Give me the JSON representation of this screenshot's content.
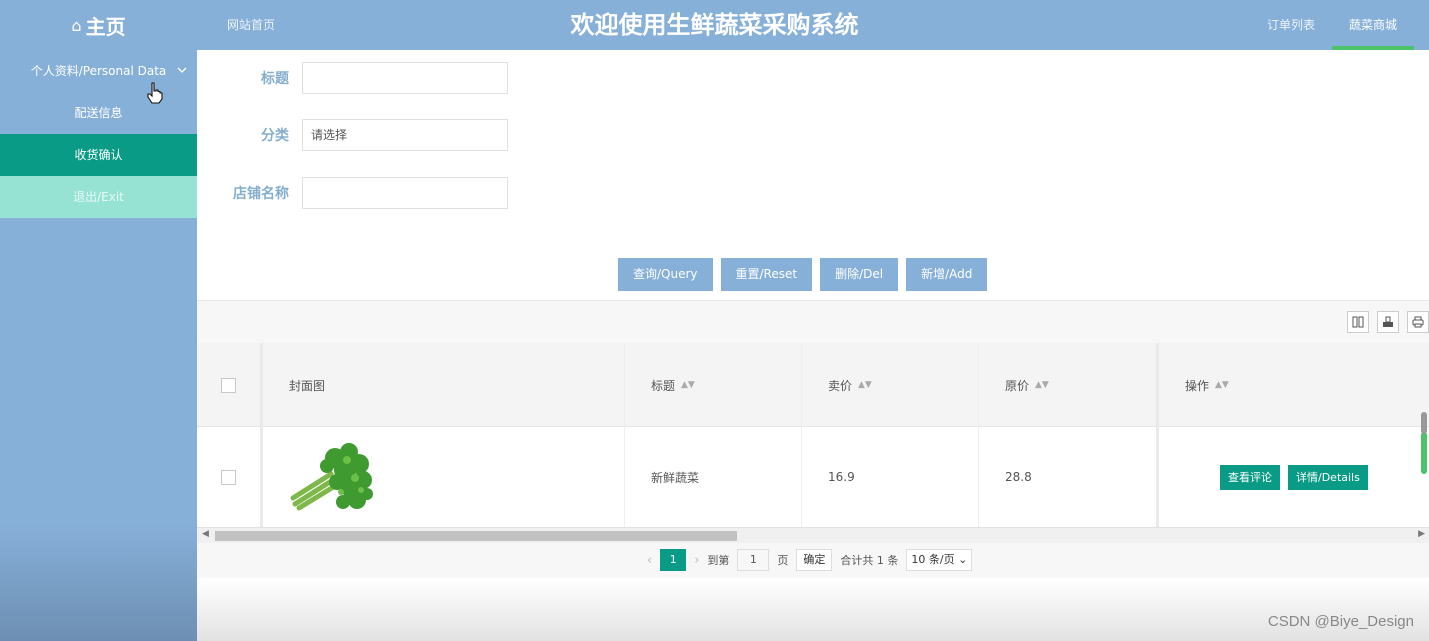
{
  "header": {
    "brand": "主页",
    "site_home": "网站首页",
    "title": "欢迎使用生鲜蔬菜采购系统",
    "nav": [
      {
        "label": "订单列表",
        "active": false
      },
      {
        "label": "蔬菜商城",
        "active": true
      }
    ]
  },
  "sidebar": {
    "group": "个人资料/Personal Data",
    "items": [
      {
        "label": "配送信息"
      },
      {
        "label": "收货确认",
        "selected": true
      },
      {
        "label": "退出/Exit"
      }
    ]
  },
  "form": {
    "title_label": "标题",
    "category_label": "分类",
    "category_placeholder": "请选择",
    "shop_label": "店铺名称"
  },
  "buttons": {
    "query": "查询/Query",
    "reset": "重置/Reset",
    "delete": "删除/Del",
    "add": "新增/Add"
  },
  "table": {
    "columns": [
      "封面图",
      "标题",
      "卖价",
      "原价",
      "操作"
    ],
    "rows": [
      {
        "title": "新鲜蔬菜",
        "price": "16.9",
        "orig_price": "28.8",
        "actions": [
          "查看评论",
          "详情/Details"
        ]
      }
    ]
  },
  "pager": {
    "current": "1",
    "goto_label": "到第",
    "goto_value": "1",
    "page_unit": "页",
    "confirm": "确定",
    "total": "合计共 1 条",
    "page_size": "10 条/页"
  },
  "watermark": "CSDN @Biye_Design",
  "colors": {
    "primary": "#87b0d9",
    "accent": "#0a9b86",
    "exit": "#96e2d3",
    "active_underline": "#4cc36b"
  }
}
